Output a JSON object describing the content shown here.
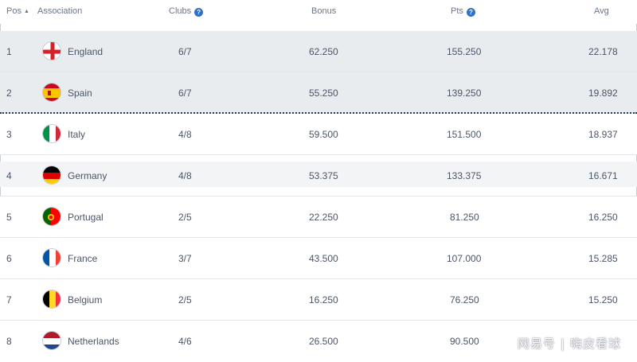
{
  "header": {
    "pos": "Pos",
    "association": "Association",
    "clubs": "Clubs",
    "bonus": "Bonus",
    "pts": "Pts",
    "avg": "Avg"
  },
  "rows": [
    {
      "pos": "1",
      "name": "England",
      "clubs": "6/7",
      "bonus": "62.250",
      "pts": "155.250",
      "avg": "22.178",
      "flag": "england-flag-icon"
    },
    {
      "pos": "2",
      "name": "Spain",
      "clubs": "6/7",
      "bonus": "55.250",
      "pts": "139.250",
      "avg": "19.892",
      "flag": "spain-flag-icon"
    },
    {
      "pos": "3",
      "name": "Italy",
      "clubs": "4/8",
      "bonus": "59.500",
      "pts": "151.500",
      "avg": "18.937",
      "flag": "italy-flag-icon"
    },
    {
      "pos": "4",
      "name": "Germany",
      "clubs": "4/8",
      "bonus": "53.375",
      "pts": "133.375",
      "avg": "16.671",
      "flag": "germany-flag-icon"
    },
    {
      "pos": "5",
      "name": "Portugal",
      "clubs": "2/5",
      "bonus": "22.250",
      "pts": "81.250",
      "avg": "16.250",
      "flag": "portugal-flag-icon"
    },
    {
      "pos": "6",
      "name": "France",
      "clubs": "3/7",
      "bonus": "43.500",
      "pts": "107.000",
      "avg": "15.285",
      "flag": "france-flag-icon"
    },
    {
      "pos": "7",
      "name": "Belgium",
      "clubs": "2/5",
      "bonus": "16.250",
      "pts": "76.250",
      "avg": "15.250",
      "flag": "belgium-flag-icon"
    },
    {
      "pos": "8",
      "name": "Netherlands",
      "clubs": "4/6",
      "bonus": "26.500",
      "pts": "90.500",
      "avg": "",
      "flag": "netherlands-flag-icon"
    }
  ],
  "watermark": {
    "left": "网易号",
    "right": "嗨皮看球"
  }
}
